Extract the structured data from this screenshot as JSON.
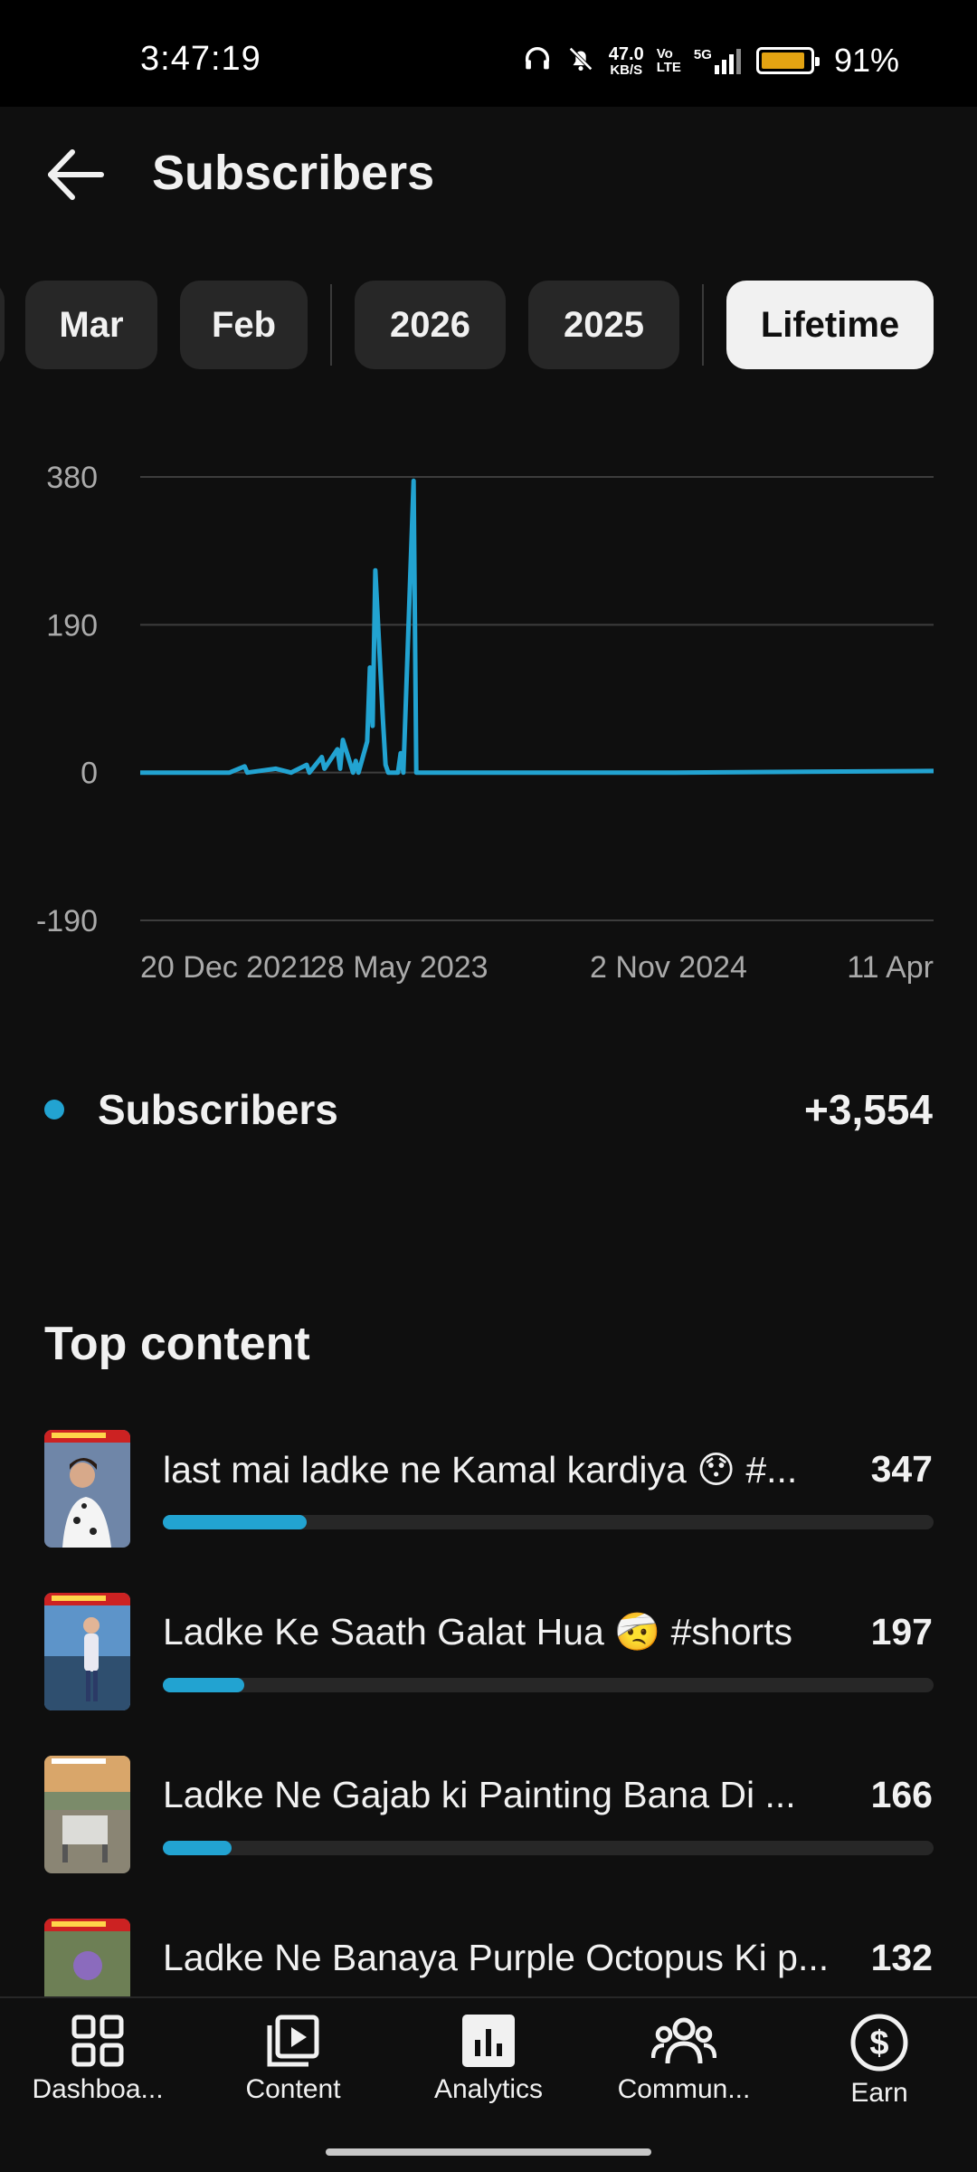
{
  "status_bar": {
    "time": "3:47:19",
    "net_speed_value": "47.0",
    "net_speed_unit": "KB/S",
    "volte": "Vo\nLTE",
    "network": "5G",
    "battery_percent": "91%",
    "battery_level": 0.91,
    "battery_color": "#e3a312"
  },
  "header": {
    "back_icon": "arrow-left-icon",
    "title": "Subscribers"
  },
  "period_chips": [
    {
      "label": "Mar",
      "selected": false
    },
    {
      "label": "Feb",
      "selected": false
    },
    {
      "label": "2026",
      "selected": false
    },
    {
      "label": "2025",
      "selected": false
    },
    {
      "label": "Lifetime",
      "selected": true
    }
  ],
  "chart_data": {
    "type": "line",
    "x_tick_labels": [
      "20 Dec 2021",
      "28 May 2023",
      "2 Nov 2024",
      "11 Apr"
    ],
    "y_ticks": [
      380,
      190,
      0,
      -190
    ],
    "ylim": [
      -190,
      380
    ],
    "grid": true,
    "series": [
      {
        "name": "Subscribers",
        "color": "#22a3d1",
        "points": [
          {
            "x": "20 Dec 2021",
            "y": 0
          },
          {
            "x": "Jun 2022",
            "y": 0
          },
          {
            "x": "Jul 2022",
            "y": 8
          },
          {
            "x": "Jul 2022",
            "y": 0
          },
          {
            "x": "Sep 2022",
            "y": 5
          },
          {
            "x": "Oct 2022",
            "y": 0
          },
          {
            "x": "Nov 2022",
            "y": 10
          },
          {
            "x": "Nov 2022",
            "y": 0
          },
          {
            "x": "Dec 2022",
            "y": 20
          },
          {
            "x": "Dec 2022",
            "y": 5
          },
          {
            "x": "Jan 2023",
            "y": 30
          },
          {
            "x": "Jan 2023",
            "y": 5
          },
          {
            "x": "Jan 2023",
            "y": 42
          },
          {
            "x": "Feb 2023",
            "y": 0
          },
          {
            "x": "Feb 2023",
            "y": 15
          },
          {
            "x": "Feb 2023",
            "y": 0
          },
          {
            "x": "Mar 2023",
            "y": 40
          },
          {
            "x": "Mar 2023",
            "y": 135
          },
          {
            "x": "Mar 2023",
            "y": 60
          },
          {
            "x": "Mar 2023",
            "y": 260
          },
          {
            "x": "Apr 2023",
            "y": 70
          },
          {
            "x": "Apr 2023",
            "y": 10
          },
          {
            "x": "Apr 2023",
            "y": 0
          },
          {
            "x": "May 2023",
            "y": 0
          },
          {
            "x": "May 2023",
            "y": 25
          },
          {
            "x": "May 2023",
            "y": 0
          },
          {
            "x": "Jun 2023",
            "y": 375
          },
          {
            "x": "Jun 2023",
            "y": 0
          },
          {
            "x": "Nov 2024",
            "y": 0
          },
          {
            "x": "11 Apr",
            "y": 2
          }
        ]
      }
    ]
  },
  "legend": {
    "label": "Subscribers",
    "value": "+3,554"
  },
  "top_content": {
    "title": "Top content",
    "items": [
      {
        "title": "last mai ladke ne Kamal kardiya 😯 #...",
        "count": "347",
        "fraction": 0.187
      },
      {
        "title": "Ladke Ke Saath Galat Hua 🤕 #shorts",
        "count": "197",
        "fraction": 0.106
      },
      {
        "title": "Ladke Ne Gajab ki Painting Bana Di ...",
        "count": "166",
        "fraction": 0.089
      },
      {
        "title": "Ladke Ne Banaya Purple Octopus Ki p...",
        "count": "132",
        "fraction": 0.071
      }
    ]
  },
  "bottom_nav": [
    {
      "label": "Dashboa...",
      "icon": "dashboard-icon"
    },
    {
      "label": "Content",
      "icon": "content-play-icon"
    },
    {
      "label": "Analytics",
      "icon": "analytics-icon",
      "active": true
    },
    {
      "label": "Commun...",
      "icon": "community-icon"
    },
    {
      "label": "Earn",
      "icon": "dollar-icon"
    }
  ]
}
